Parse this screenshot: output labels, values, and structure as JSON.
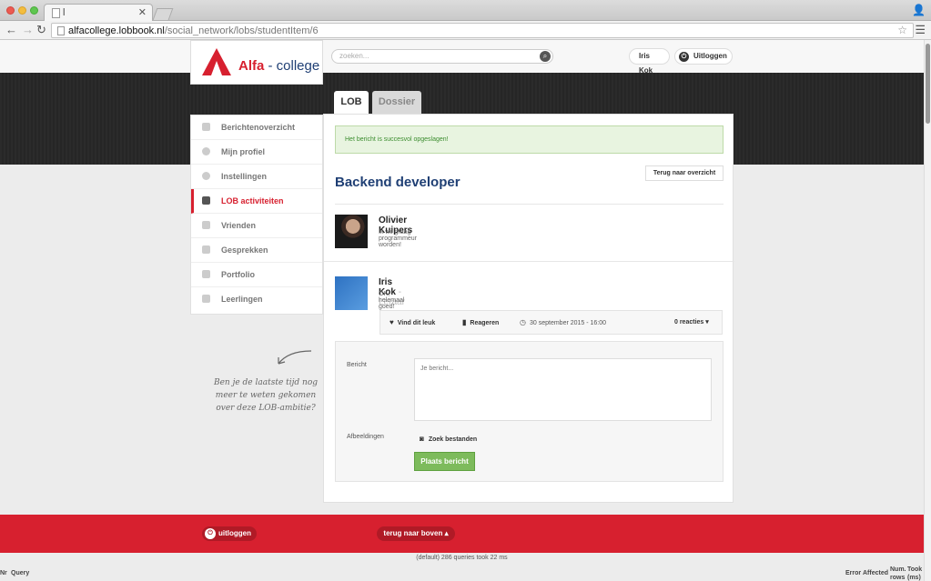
{
  "browser": {
    "tab_title": "l",
    "url_host": "alfacollege.lobbook.nl",
    "url_path": "/social_network/lobs/studentItem/6"
  },
  "header": {
    "logo_main": "Alfa",
    "logo_sub": "- college",
    "search_placeholder": "zoeken...",
    "user_name": "Iris Kok",
    "logout_label": "Uitloggen"
  },
  "tabs": [
    {
      "label": "LOB"
    },
    {
      "label": "Dossier"
    }
  ],
  "sidebar": {
    "items": [
      {
        "label": "Berichtenoverzicht",
        "icon": "speech-bubble-icon"
      },
      {
        "label": "Mijn profiel",
        "icon": "user-icon"
      },
      {
        "label": "Instellingen",
        "icon": "settings-icon"
      },
      {
        "label": "LOB activiteiten",
        "icon": "document-icon",
        "active": true
      },
      {
        "label": "Vrienden",
        "icon": "friends-icon"
      },
      {
        "label": "Gesprekken",
        "icon": "chat-icon"
      },
      {
        "label": "Portfolio",
        "icon": "portfolio-icon"
      },
      {
        "label": "Leerlingen",
        "icon": "students-icon"
      }
    ]
  },
  "main": {
    "alert": "Het bericht is succesvol opgeslagen!",
    "back_button": "Terug naar overzicht",
    "title": "Backend developer",
    "student": {
      "name": "Olivier Kuipers",
      "text": "Ik wil graag programmeur worden!"
    },
    "comment": {
      "name": "Iris Kok",
      "role": "- Leraar",
      "text": "OK, helemaal goed!"
    },
    "actions": {
      "like": "Vind dit leuk",
      "reply": "Reageren",
      "date": "30 september 2015 - 16:00",
      "reactions": "0 reacties"
    },
    "form": {
      "message_label": "Bericht",
      "message_placeholder": "Je bericht...",
      "images_label": "Afbeeldingen",
      "file_button": "Zoek bestanden",
      "submit": "Plaats bericht"
    }
  },
  "note": "Ben je de laatste tijd nog meer te weten gekomen over deze LOB-ambitie?",
  "footer": {
    "logout": "uitloggen",
    "back_to_top": "terug naar boven"
  },
  "debug": {
    "summary": "(default) 286 queries took 22 ms",
    "col_nr": "Nr",
    "col_query": "Query",
    "col_error": "Error",
    "col_affected": "Affected",
    "col_num": "Num. rows",
    "col_took": "Took (ms)"
  },
  "colors": {
    "brand_red": "#d7202f",
    "brand_blue": "#1f3f74",
    "success_green": "#7dbb5c"
  }
}
